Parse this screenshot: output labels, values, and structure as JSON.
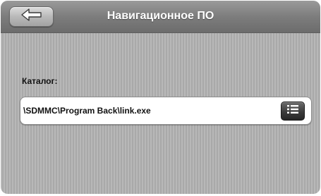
{
  "header": {
    "title": "Навигационное ПО",
    "back_icon": "back-arrow-icon"
  },
  "main": {
    "catalog_label": "Каталог:",
    "path_value": "\\SDMMC\\Program Back\\link.exe",
    "browse_icon": "list-icon"
  },
  "colors": {
    "titlebar": "#7d7d7d",
    "background": "#b2b2b2",
    "field": "#ffffff",
    "browse_button": "#3c3c3c"
  }
}
